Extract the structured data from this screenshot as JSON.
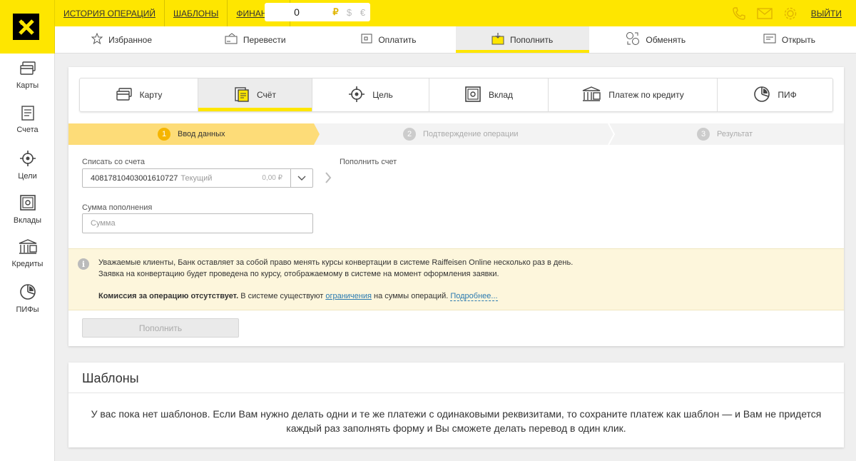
{
  "header": {
    "nav": [
      "ИСТОРИЯ ОПЕРАЦИЙ",
      "ШАБЛОНЫ",
      "ФИНАНСЫ"
    ],
    "balance": "0",
    "currencies": [
      "₽",
      "$",
      "€"
    ],
    "logout": "ВЫЙТИ"
  },
  "menu": [
    "Избранное",
    "Перевести",
    "Оплатить",
    "Пополнить",
    "Обменять",
    "Открыть"
  ],
  "sidebar": [
    "Карты",
    "Счета",
    "Цели",
    "Вклады",
    "Кредиты",
    "ПИФы"
  ],
  "subtabs": [
    "Карту",
    "Счёт",
    "Цель",
    "Вклад",
    "Платеж по кредиту",
    "ПИФ"
  ],
  "steps": [
    {
      "num": "1",
      "label": "Ввод данных"
    },
    {
      "num": "2",
      "label": "Подтверждение операции"
    },
    {
      "num": "3",
      "label": "Результат"
    }
  ],
  "form": {
    "from_label": "Списать со счета",
    "account_number": "40817810403001610727",
    "account_type": "Текущий",
    "account_balance": "0,00 ₽",
    "to_label": "Пополнить счет",
    "amount_label": "Сумма пополнения",
    "amount_placeholder": "Сумма",
    "submit": "Пополнить"
  },
  "notice": {
    "line1": "Уважаемые клиенты, Банк оставляет за собой право менять курсы конвертации в системе Raiffeisen Online несколько раз в день.",
    "line2": "Заявка на конвертацию будет проведена по курсу, отображаемому в системе на момент оформления заявки.",
    "bold": "Комиссия за операцию отсутствует.",
    "text_a": " В системе существуют ",
    "link1": "ограничения",
    "text_b": " на суммы операций. ",
    "link2": "Подробнее..."
  },
  "templates": {
    "title": "Шаблоны",
    "message": "У вас пока нет шаблонов. Если Вам нужно делать одни и те же платежи с одинаковыми реквизитами, то сохраните платеж как шаблон — и Вам не придется каждый раз заполнять форму и Вы сможете делать перевод в один клик."
  },
  "colors": {
    "brand": "#fee600",
    "accent": "#f5b500",
    "link": "#2a7ab0"
  },
  "icons": {
    "header": [
      "phone-icon",
      "mail-icon",
      "gear-icon"
    ],
    "menu": [
      "star-icon",
      "transfer-icon",
      "pay-icon",
      "topup-icon",
      "exchange-icon",
      "open-account-icon"
    ],
    "sidebar": [
      "card-icon",
      "account-icon",
      "target-icon",
      "safe-icon",
      "credit-icon",
      "fund-icon"
    ]
  }
}
